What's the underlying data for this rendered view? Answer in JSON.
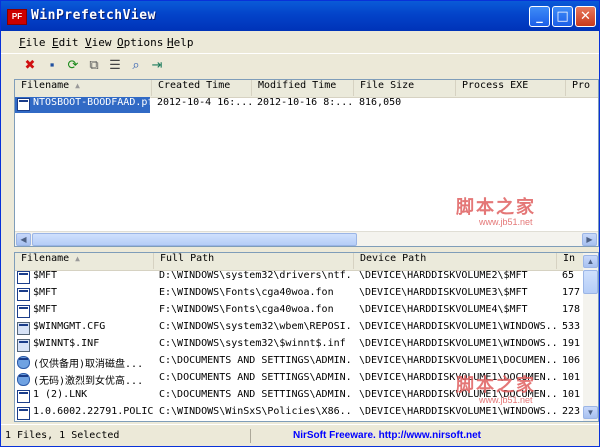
{
  "window": {
    "title": "WinPrefetchView",
    "icon_label": "PF",
    "controls": {
      "minimize": "_",
      "maximize": "□",
      "close": "✕"
    }
  },
  "menu": [
    {
      "key": "F",
      "rest": "ile"
    },
    {
      "key": "E",
      "rest": "dit"
    },
    {
      "key": "V",
      "rest": "iew"
    },
    {
      "key": "O",
      "rest": "ptions"
    },
    {
      "key": "H",
      "rest": "elp"
    }
  ],
  "toolbar": [
    {
      "name": "delete-icon",
      "glyph": "✖",
      "color": "#d01010"
    },
    {
      "name": "save-icon",
      "glyph": "▪",
      "color": "#2050a0"
    },
    {
      "name": "refresh-icon",
      "glyph": "⟳",
      "color": "#1a8a1a"
    },
    {
      "name": "copy-icon",
      "glyph": "⧉",
      "color": "#555555"
    },
    {
      "name": "properties-icon",
      "glyph": "☰",
      "color": "#444444"
    },
    {
      "name": "find-icon",
      "glyph": "⌕",
      "color": "#2a5ab0"
    },
    {
      "name": "exit-icon",
      "glyph": "⇥",
      "color": "#1a7a5a"
    }
  ],
  "top_list": {
    "columns": [
      "Filename",
      "Created Time",
      "Modified Time",
      "File Size",
      "Process EXE",
      "Pro"
    ],
    "rows": [
      [
        "NTOSBOOT-BOODFAAD.pf",
        "2012-10-4 16:...",
        "2012-10-16 8:...",
        "816,050",
        "",
        ""
      ]
    ]
  },
  "bottom_list": {
    "columns": [
      "Filename",
      "Full Path",
      "Device Path",
      "In"
    ],
    "rows": [
      [
        "$MFT",
        "D:\\WINDOWS\\system32\\drivers\\ntf...",
        "\\DEVICE\\HARDDISKVOLUME2\\$MFT",
        "65"
      ],
      [
        "$MFT",
        "E:\\WINDOWS\\Fonts\\cga40woa.fon",
        "\\DEVICE\\HARDDISKVOLUME3\\$MFT",
        "177"
      ],
      [
        "$MFT",
        "F:\\WINDOWS\\Fonts\\cga40woa.fon",
        "\\DEVICE\\HARDDISKVOLUME4\\$MFT",
        "178"
      ],
      [
        "$WINMGMT.CFG",
        "C:\\WINDOWS\\system32\\wbem\\REPOSI...",
        "\\DEVICE\\HARDDISKVOLUME1\\WINDOWS...",
        "533"
      ],
      [
        "$WINNT$.INF",
        "C:\\WINDOWS\\system32\\$winnt$.inf",
        "\\DEVICE\\HARDDISKVOLUME1\\WINDOWS...",
        "191"
      ],
      [
        "(仅供备用)取消磁盘...",
        "C:\\DOCUMENTS AND SETTINGS\\ADMIN...",
        "\\DEVICE\\HARDDISKVOLUME1\\DOCUMEN...",
        "106"
      ],
      [
        "(无码)激烈到女优高...",
        "C:\\DOCUMENTS AND SETTINGS\\ADMIN...",
        "\\DEVICE\\HARDDISKVOLUME1\\DOCUMEN...",
        "101"
      ],
      [
        "1 (2).LNK",
        "C:\\DOCUMENTS AND SETTINGS\\ADMIN...",
        "\\DEVICE\\HARDDISKVOLUME1\\DOCUMEN...",
        "101"
      ],
      [
        "1.0.6002.22791.POLICY...",
        "C:\\WINDOWS\\WinSxS\\Policies\\X86...",
        "\\DEVICE\\HARDDISKVOLUME1\\WINDOWS...",
        "223"
      ]
    ]
  },
  "status": {
    "selection": "1 Files, 1 Selected",
    "link": "NirSoft Freeware.  http://www.nirsoft.net"
  },
  "watermark": {
    "text": "脚本之家",
    "url": "www.jb51.net"
  }
}
